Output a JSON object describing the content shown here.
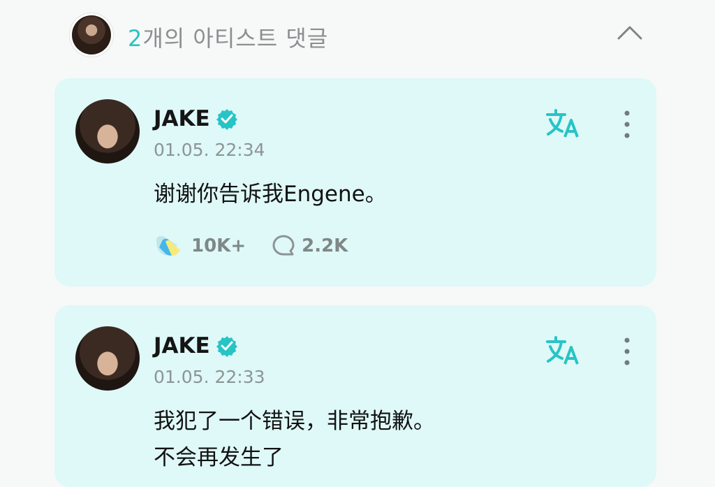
{
  "header": {
    "count": "2",
    "title": "개의 아티스트 댓글"
  },
  "comments": [
    {
      "author": "JAKE",
      "time": "01.05. 22:34",
      "text": "谢谢你告诉我Engene。",
      "likes": "10K+",
      "replies": "2.2K"
    },
    {
      "author": "JAKE",
      "time": "01.05. 22:33",
      "line1": "我犯了一个错误，非常抱歉。",
      "line2": "不会再发生了"
    }
  ],
  "icons": {
    "accent": "#27c4c6",
    "translate": "translate-icon",
    "more": "more-vertical-icon",
    "verified": "verified-badge-icon"
  }
}
